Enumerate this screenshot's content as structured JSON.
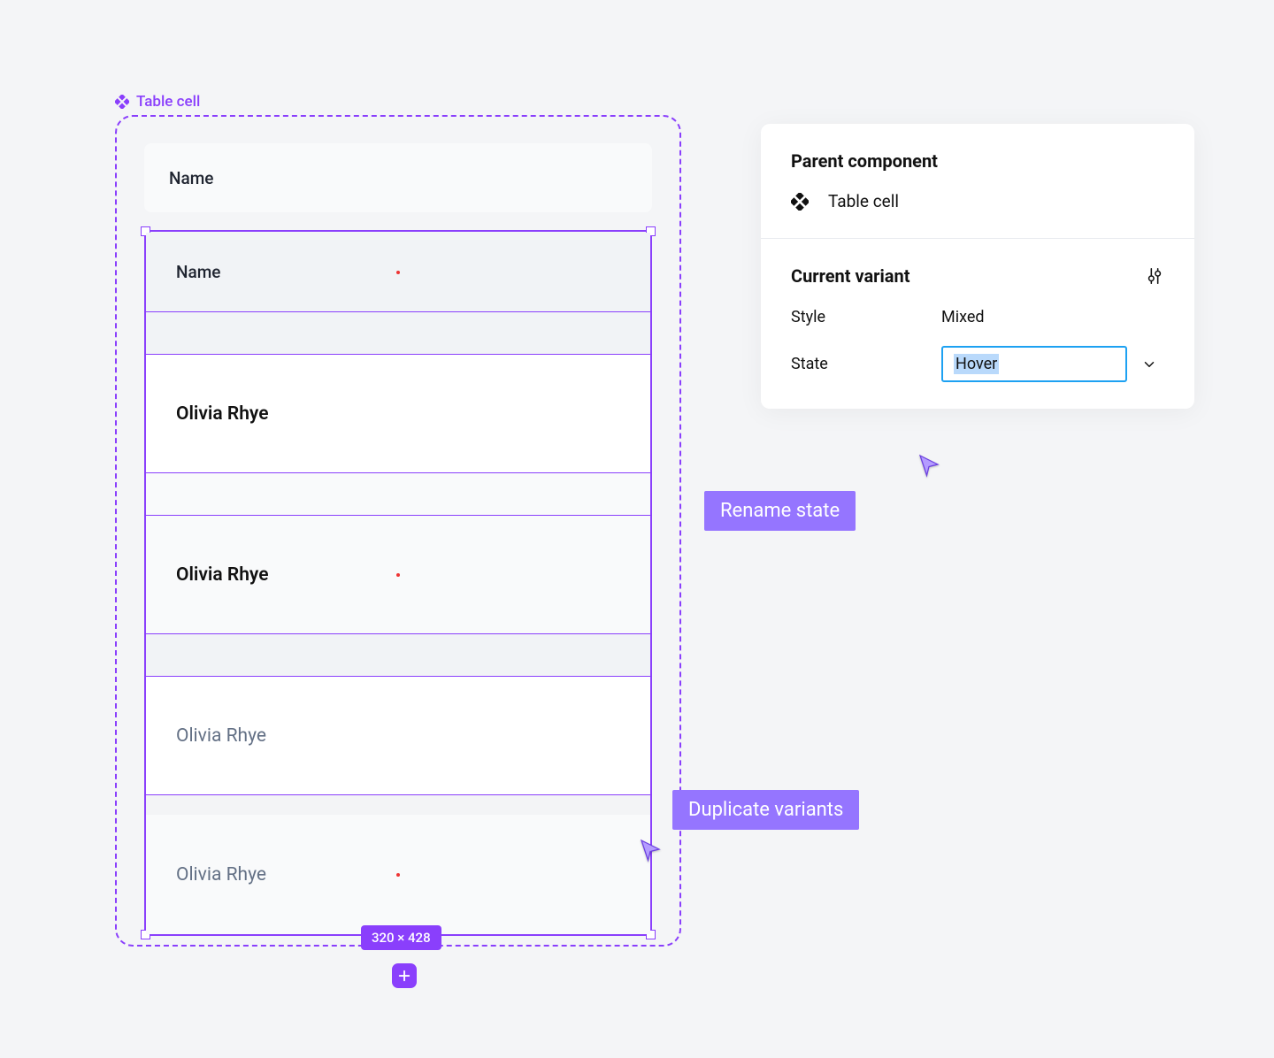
{
  "canvas": {
    "label": "Table cell"
  },
  "header": {
    "label": "Name"
  },
  "variants": {
    "header2": "Name",
    "bold": "Olivia Rhye",
    "boldGrey": "Olivia Rhye",
    "regular": "Olivia Rhye",
    "regularGrey": "Olivia Rhye"
  },
  "dimensions": "320 × 428",
  "inspector": {
    "parentHeading": "Parent component",
    "componentName": "Table cell",
    "currentVariantHeading": "Current variant",
    "styleLabel": "Style",
    "styleValue": "Mixed",
    "stateLabel": "State",
    "stateValue": "Hover"
  },
  "tooltips": {
    "rename": "Rename state",
    "duplicate": "Duplicate variants"
  }
}
